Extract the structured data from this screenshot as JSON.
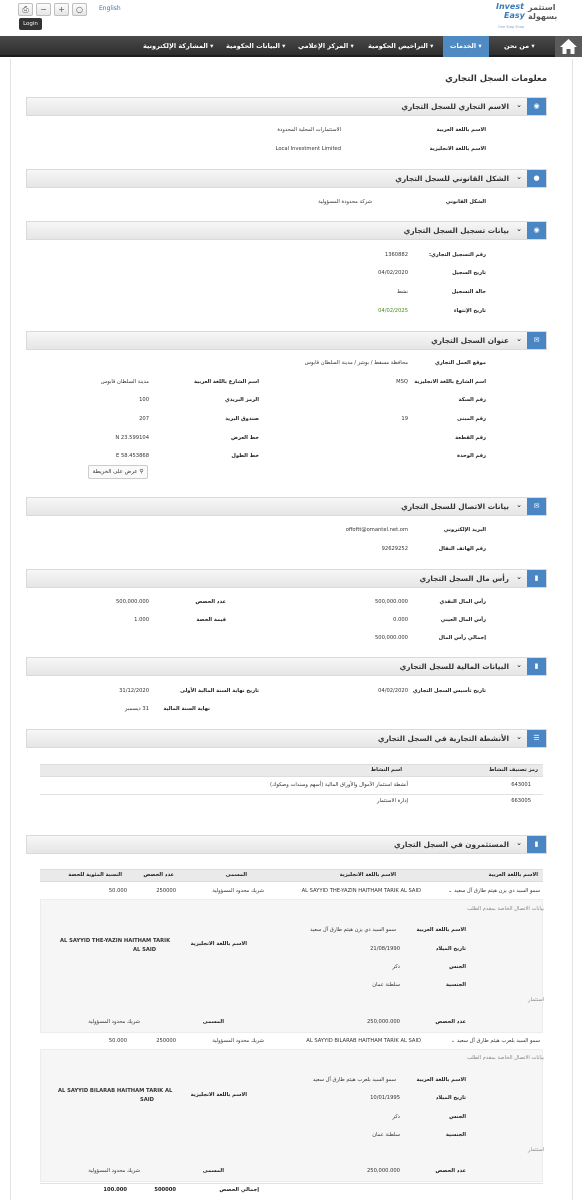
{
  "toolbar": {
    "lang": "English",
    "login": "Login",
    "print_icon": "print-icon",
    "minus_icon": "minus-icon",
    "plus_icon": "plus-icon",
    "reset_icon": "reset-icon"
  },
  "logo": {
    "text_en1": "Invest",
    "text_en2": "Easy",
    "text_ar1": "استثمر",
    "text_ar2": "بسهولة",
    "tagline": "One Stop Shop"
  },
  "nav": {
    "home": "home-icon",
    "items": [
      "من نحن",
      "الخدمات",
      "التراخيص الحكومية",
      "المركز الإعلامي",
      "البيانات الحكومية",
      "المشاركة الإلكترونية"
    ]
  },
  "page_title": "معلومات السجل التجاري",
  "sections": {
    "name": {
      "title": "الاسم التجاري للسجل التجاري",
      "ar_label": "الاسم باللغة العربية",
      "ar_value": "الاستثمارات المحلية المحدودة",
      "en_label": "الاسم باللغة الانجليزية",
      "en_value": "Local Investment Limited"
    },
    "legal": {
      "title": "الشكل القانوني للسجل التجاري",
      "label": "الشكل القانوني",
      "value": "شركة محدودة المسؤولية"
    },
    "reg": {
      "title": "بيانات تسجيل السجل التجاري",
      "no_label": "رقم التسجيل التجاري:",
      "no_value": "1360882",
      "date_label": "تاريخ السجيل",
      "date_value": "04/02/2020",
      "status_label": "حالة التسجيل",
      "status_value": "نشط",
      "exp_label": "تاريخ الإنتهاء",
      "exp_value": "04/02/2025"
    },
    "address": {
      "title": "عنوان السجل التجاري",
      "loc_label": "موقع العمل التجاري",
      "loc_value": "محافظة مسقط / بوشر / مدينة السلطان قابوس",
      "st_en_label": "اسم الشارع باللغة الانجليزية",
      "st_en_value": "MSQ",
      "st_ar_label": "اسم الشارع باللغة العربية",
      "st_ar_value": "مدينة السلطان قابوس",
      "way_label": "رقم السكة",
      "way_value": "",
      "postal_label": "الرمز البريدي",
      "postal_value": "100",
      "bldg_label": "رقم المبنى",
      "bldg_value": "19",
      "pobox_label": "صندوق البريد",
      "pobox_value": "207",
      "plot_label": "رقم القطعة",
      "plot_value": "",
      "lat_label": "خط العرض",
      "lat_value": "N 23.599104",
      "unit_label": "رقم الوحدة",
      "unit_value": "",
      "lng_label": "خط الطول",
      "lng_value": "E 58.453868",
      "map_button": "عرض على الخريطة"
    },
    "contact": {
      "title": "بيانات الاتصال للسجل التجاري",
      "email_label": "البريد الإلكتروني",
      "email_value": "offoftt@omantel.net.om",
      "phone_label": "رقم الهاتف النقال",
      "phone_value": "92629252"
    },
    "capital": {
      "title": "رأس مال السجل التجاري",
      "cash_label": "رأس المال النقدي",
      "cash_value": "500,000.000",
      "inkind_label": "رأس المال العيني",
      "inkind_value": "0.000",
      "total_label": "إجمالي رأس المال",
      "total_value": "500,000.000",
      "shares_label": "عدد الحصص",
      "shares_value": "500,000.000",
      "sharev_label": "قيمة الحصة",
      "sharev_value": "1.000"
    },
    "financial": {
      "title": "البيانات المالية للسجل التجاري",
      "est_label": "تاريخ تأسيس السجل التجاري",
      "est_value": "04/02/2020",
      "fy_first_label": "تاريخ نهاية السنة المالية الأولى",
      "fy_first_value": "31/12/2020",
      "fy_end_label": "نهاية السنة المالية",
      "fy_end_value": "31 ديسمبر"
    },
    "activities": {
      "title": "الأنشطة التجارية في السجل التجاري",
      "headers": [
        "رمز تصنيف النشاط",
        "اسم النشاط"
      ],
      "rows": [
        {
          "code": "643001",
          "name": "أنشطة استثمار الأموال والأوراق المالية (أسهم وسندات وصكوك)"
        },
        {
          "code": "663005",
          "name": "إدارة الاستثمار"
        }
      ]
    },
    "investors": {
      "title": "المستثمرون في السجل التجاري",
      "headers": [
        "الاسم باللغة العربية",
        "الاسم باللغة الانجليزية",
        "المسمى",
        "عدد الحصص",
        "النسبة المئوية للحصة"
      ],
      "contact_caption": "بيانات الاتصال الخاصة بمقدم الطلب",
      "investment_caption": "استثمار",
      "ar_name_label": "الاسم باللغة العربية",
      "en_name_label": "الاسم باللغة الانجليزية",
      "dob_label": "تاريخ الميلاد",
      "gender_label": "الجنس",
      "nat_label": "الجنسية",
      "shares_label": "عدد الحصص",
      "title_label": "المسمى",
      "rows": [
        {
          "ar": "سمو السيد ذي يزن هيثم طارق آل سعيد",
          "en": "AL SAYYID THE-YAZIN HAITHAM TARIK AL SAID",
          "role": "شريك محدود المسؤولية",
          "shares": "250000",
          "pct": "50.000",
          "en_l1": "AL SAYYID THE-YAZIN HAITHAM TARIK",
          "en_l2": "AL SAID",
          "ar_full": "سمو السيد ذي يزن هيثم طارق آل سعيد",
          "dob": "21/08/1990",
          "gender": "ذكر",
          "nat": "سلطنة عمان",
          "shares_full": "250,000.000"
        },
        {
          "ar": "سمو السيد بلعرب هيثم طارق آل سعيد",
          "en": "AL SAYYID BILARAB HAITHAM TARIK AL SAID",
          "role": "شريك محدود المسؤولية",
          "shares": "250000",
          "pct": "50.000",
          "en_l1": "AL SAYYID BILARAB HAITHAM TARIK AL",
          "en_l2": "SAID",
          "ar_full": "سمو السيد بلعرب هيثم طارق آل سعيد",
          "dob": "10/01/1995",
          "gender": "ذكر",
          "nat": "سلطنة عمان",
          "shares_full": "250,000.000"
        }
      ],
      "total_label": "إجمالي الحصص",
      "total_shares": "500000",
      "total_pct": "100.000"
    }
  }
}
